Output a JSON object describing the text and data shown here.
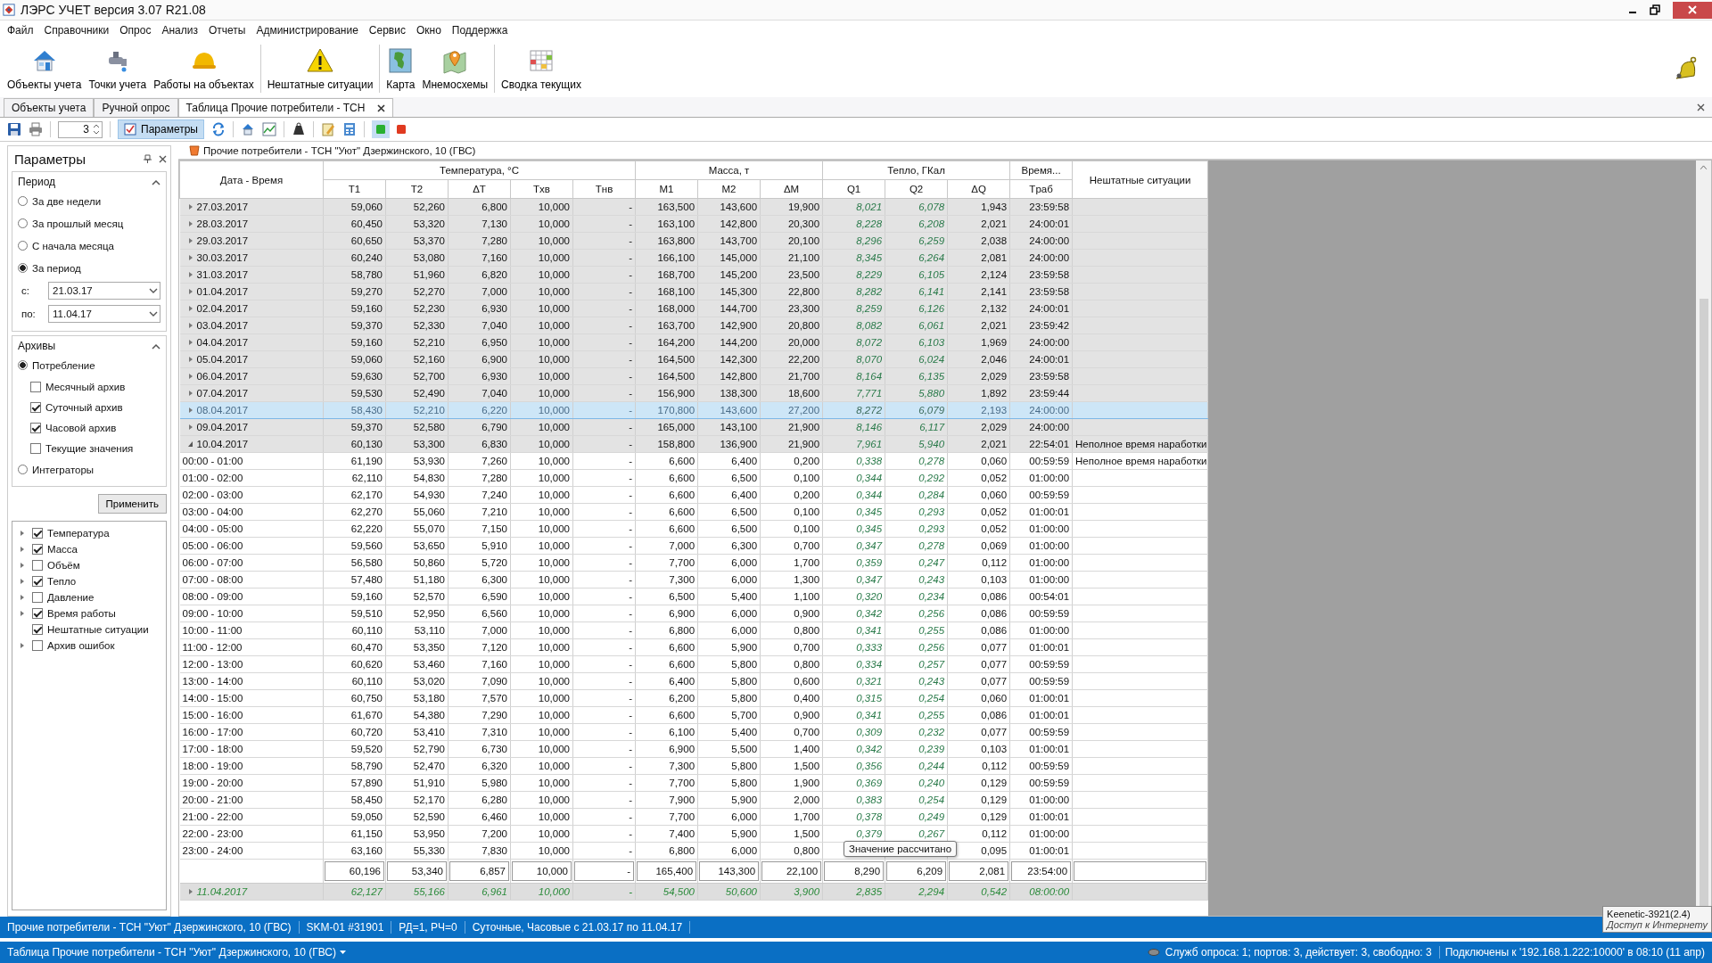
{
  "window": {
    "title": "ЛЭРС УЧЕТ версия 3.07 R21.08"
  },
  "menu": [
    "Файл",
    "Справочники",
    "Опрос",
    "Анализ",
    "Отчеты",
    "Администрирование",
    "Сервис",
    "Окно",
    "Поддержка"
  ],
  "toolbar": [
    {
      "label": "Объекты учета"
    },
    {
      "label": "Точки учета"
    },
    {
      "label": "Работы на объектах"
    },
    {
      "label": "Нештатные ситуации"
    },
    {
      "label": "Карта"
    },
    {
      "label": "Мнемосхемы"
    },
    {
      "label": "Сводка текущих"
    }
  ],
  "doc_tabs": [
    {
      "label": "Объекты учета",
      "selected": false
    },
    {
      "label": "Ручной опрос",
      "selected": false
    },
    {
      "label": "Таблица Прочие потребители - ТСН",
      "selected": true
    }
  ],
  "subtoolbar": {
    "counter": "3",
    "params_button": {
      "label": "Параметры",
      "selected": true
    }
  },
  "params_panel": {
    "title": "Параметры",
    "period": {
      "title": "Период",
      "options": [
        {
          "label": "За две недели",
          "selected": false
        },
        {
          "label": "За прошлый месяц",
          "selected": false
        },
        {
          "label": "С начала месяца",
          "selected": false
        },
        {
          "label": "За период",
          "selected": true
        }
      ],
      "from_label": "с:",
      "from": "21.03.17",
      "to_label": "по:",
      "to": "11.04.17"
    },
    "archives": {
      "title": "Архивы",
      "options": [
        {
          "label": "Потребление",
          "selected": true,
          "children": [
            {
              "label": "Месячный архив",
              "checked": false
            },
            {
              "label": "Суточный архив",
              "checked": true
            },
            {
              "label": "Часовой архив",
              "checked": true
            },
            {
              "label": "Текущие значения",
              "checked": false
            }
          ]
        },
        {
          "label": "Интеграторы",
          "selected": false
        }
      ]
    },
    "apply": "Применить",
    "tree": [
      {
        "label": "Температура",
        "checked": true,
        "has_children": true
      },
      {
        "label": "Масса",
        "checked": true,
        "has_children": true
      },
      {
        "label": "Объём",
        "checked": false,
        "has_children": true
      },
      {
        "label": "Тепло",
        "checked": true,
        "has_children": true
      },
      {
        "label": "Давление",
        "checked": false,
        "has_children": true
      },
      {
        "label": "Время работы",
        "checked": true,
        "has_children": true
      },
      {
        "label": "Нештатные ситуации",
        "checked": true,
        "has_children": false
      },
      {
        "label": "Архив ошибок",
        "checked": false,
        "has_children": true
      }
    ]
  },
  "data_title": "Прочие потребители - ТСН \"Уют\"  Дзержинского, 10 (ГВС)",
  "table": {
    "date_header": "Дата - Время",
    "events_header": "Нештатные ситуации",
    "groups": [
      {
        "label": "Температура, °C",
        "columns": [
          "T1",
          "T2",
          "ΔT",
          "Tхв",
          "Tнв"
        ]
      },
      {
        "label": "Масса, т",
        "columns": [
          "M1",
          "M2",
          "ΔM"
        ]
      },
      {
        "label": "Тепло, ГКал",
        "columns": [
          "Q1",
          "Q2",
          "ΔQ"
        ]
      },
      {
        "label": "Время...",
        "columns": [
          "Tраб"
        ]
      }
    ],
    "rows": [
      {
        "kind": "day",
        "expanded": false,
        "selected": false,
        "date": "27.03.2017",
        "cells": [
          "59,060",
          "52,260",
          "6,800",
          "10,000",
          "-",
          "163,500",
          "143,600",
          "19,900",
          "8,021",
          "6,078",
          "1,943",
          "23:59:58"
        ]
      },
      {
        "kind": "day",
        "expanded": false,
        "selected": false,
        "date": "28.03.2017",
        "cells": [
          "60,450",
          "53,320",
          "7,130",
          "10,000",
          "-",
          "163,100",
          "142,800",
          "20,300",
          "8,228",
          "6,208",
          "2,021",
          "24:00:01"
        ]
      },
      {
        "kind": "day",
        "expanded": false,
        "selected": false,
        "date": "29.03.2017",
        "cells": [
          "60,650",
          "53,370",
          "7,280",
          "10,000",
          "-",
          "163,800",
          "143,700",
          "20,100",
          "8,296",
          "6,259",
          "2,038",
          "24:00:00"
        ]
      },
      {
        "kind": "day",
        "expanded": false,
        "selected": false,
        "date": "30.03.2017",
        "cells": [
          "60,240",
          "53,080",
          "7,160",
          "10,000",
          "-",
          "166,100",
          "145,000",
          "21,100",
          "8,345",
          "6,264",
          "2,081",
          "24:00:00"
        ]
      },
      {
        "kind": "day",
        "expanded": false,
        "selected": false,
        "date": "31.03.2017",
        "cells": [
          "58,780",
          "51,960",
          "6,820",
          "10,000",
          "-",
          "168,700",
          "145,200",
          "23,500",
          "8,229",
          "6,105",
          "2,124",
          "23:59:58"
        ]
      },
      {
        "kind": "day",
        "expanded": false,
        "selected": false,
        "date": "01.04.2017",
        "cells": [
          "59,270",
          "52,270",
          "7,000",
          "10,000",
          "-",
          "168,100",
          "145,300",
          "22,800",
          "8,282",
          "6,141",
          "2,141",
          "23:59:58"
        ]
      },
      {
        "kind": "day",
        "expanded": false,
        "selected": false,
        "date": "02.04.2017",
        "cells": [
          "59,160",
          "52,230",
          "6,930",
          "10,000",
          "-",
          "168,000",
          "144,700",
          "23,300",
          "8,259",
          "6,126",
          "2,132",
          "24:00:01"
        ]
      },
      {
        "kind": "day",
        "expanded": false,
        "selected": false,
        "date": "03.04.2017",
        "cells": [
          "59,370",
          "52,330",
          "7,040",
          "10,000",
          "-",
          "163,700",
          "142,900",
          "20,800",
          "8,082",
          "6,061",
          "2,021",
          "23:59:42"
        ]
      },
      {
        "kind": "day",
        "expanded": false,
        "selected": false,
        "date": "04.04.2017",
        "cells": [
          "59,160",
          "52,210",
          "6,950",
          "10,000",
          "-",
          "164,200",
          "144,200",
          "20,000",
          "8,072",
          "6,103",
          "1,969",
          "24:00:00"
        ]
      },
      {
        "kind": "day",
        "expanded": false,
        "selected": false,
        "date": "05.04.2017",
        "cells": [
          "59,060",
          "52,160",
          "6,900",
          "10,000",
          "-",
          "164,500",
          "142,300",
          "22,200",
          "8,070",
          "6,024",
          "2,046",
          "24:00:01"
        ]
      },
      {
        "kind": "day",
        "expanded": false,
        "selected": false,
        "date": "06.04.2017",
        "cells": [
          "59,630",
          "52,700",
          "6,930",
          "10,000",
          "-",
          "164,500",
          "142,800",
          "21,700",
          "8,164",
          "6,135",
          "2,029",
          "23:59:58"
        ]
      },
      {
        "kind": "day",
        "expanded": false,
        "selected": false,
        "date": "07.04.2017",
        "cells": [
          "59,530",
          "52,490",
          "7,040",
          "10,000",
          "-",
          "156,900",
          "138,300",
          "18,600",
          "7,771",
          "5,880",
          "1,892",
          "23:59:44"
        ]
      },
      {
        "kind": "day",
        "expanded": false,
        "selected": true,
        "date": "08.04.2017",
        "cells": [
          "58,430",
          "52,210",
          "6,220",
          "10,000",
          "-",
          "170,800",
          "143,600",
          "27,200",
          "8,272",
          "6,079",
          "2,193",
          "24:00:00"
        ]
      },
      {
        "kind": "day",
        "expanded": false,
        "selected": false,
        "date": "09.04.2017",
        "cells": [
          "59,370",
          "52,580",
          "6,790",
          "10,000",
          "-",
          "165,000",
          "143,100",
          "21,900",
          "8,146",
          "6,117",
          "2,029",
          "24:00:00"
        ]
      },
      {
        "kind": "day",
        "expanded": true,
        "selected": false,
        "date": "10.04.2017",
        "cells": [
          "60,130",
          "53,300",
          "6,830",
          "10,000",
          "-",
          "158,800",
          "136,900",
          "21,900",
          "7,961",
          "5,940",
          "2,021",
          "22:54:01"
        ],
        "event": "Неполное время наработки"
      },
      {
        "kind": "hour",
        "date": "00:00 - 01:00",
        "cells": [
          "61,190",
          "53,930",
          "7,260",
          "10,000",
          "-",
          "6,600",
          "6,400",
          "0,200",
          "0,338",
          "0,278",
          "0,060",
          "00:59:59"
        ],
        "event": "Неполное время наработки"
      },
      {
        "kind": "hour",
        "date": "01:00 - 02:00",
        "cells": [
          "62,110",
          "54,830",
          "7,280",
          "10,000",
          "-",
          "6,600",
          "6,500",
          "0,100",
          "0,344",
          "0,292",
          "0,052",
          "01:00:00"
        ]
      },
      {
        "kind": "hour",
        "date": "02:00 - 03:00",
        "cells": [
          "62,170",
          "54,930",
          "7,240",
          "10,000",
          "-",
          "6,600",
          "6,400",
          "0,200",
          "0,344",
          "0,284",
          "0,060",
          "00:59:59"
        ]
      },
      {
        "kind": "hour",
        "date": "03:00 - 04:00",
        "cells": [
          "62,270",
          "55,060",
          "7,210",
          "10,000",
          "-",
          "6,600",
          "6,500",
          "0,100",
          "0,345",
          "0,293",
          "0,052",
          "01:00:01"
        ]
      },
      {
        "kind": "hour",
        "date": "04:00 - 05:00",
        "cells": [
          "62,220",
          "55,070",
          "7,150",
          "10,000",
          "-",
          "6,600",
          "6,500",
          "0,100",
          "0,345",
          "0,293",
          "0,052",
          "01:00:00"
        ]
      },
      {
        "kind": "hour",
        "date": "05:00 - 06:00",
        "cells": [
          "59,560",
          "53,650",
          "5,910",
          "10,000",
          "-",
          "7,000",
          "6,300",
          "0,700",
          "0,347",
          "0,278",
          "0,069",
          "01:00:00"
        ]
      },
      {
        "kind": "hour",
        "date": "06:00 - 07:00",
        "cells": [
          "56,580",
          "50,860",
          "5,720",
          "10,000",
          "-",
          "7,700",
          "6,000",
          "1,700",
          "0,359",
          "0,247",
          "0,112",
          "01:00:00"
        ]
      },
      {
        "kind": "hour",
        "date": "07:00 - 08:00",
        "cells": [
          "57,480",
          "51,180",
          "6,300",
          "10,000",
          "-",
          "7,300",
          "6,000",
          "1,300",
          "0,347",
          "0,243",
          "0,103",
          "01:00:00"
        ]
      },
      {
        "kind": "hour",
        "date": "08:00 - 09:00",
        "cells": [
          "59,160",
          "52,570",
          "6,590",
          "10,000",
          "-",
          "6,500",
          "5,400",
          "1,100",
          "0,320",
          "0,234",
          "0,086",
          "00:54:01"
        ]
      },
      {
        "kind": "hour",
        "date": "09:00 - 10:00",
        "cells": [
          "59,510",
          "52,950",
          "6,560",
          "10,000",
          "-",
          "6,900",
          "6,000",
          "0,900",
          "0,342",
          "0,256",
          "0,086",
          "00:59:59"
        ]
      },
      {
        "kind": "hour",
        "date": "10:00 - 11:00",
        "cells": [
          "60,110",
          "53,110",
          "7,000",
          "10,000",
          "-",
          "6,800",
          "6,000",
          "0,800",
          "0,341",
          "0,255",
          "0,086",
          "01:00:00"
        ]
      },
      {
        "kind": "hour",
        "date": "11:00 - 12:00",
        "cells": [
          "60,470",
          "53,350",
          "7,120",
          "10,000",
          "-",
          "6,600",
          "5,900",
          "0,700",
          "0,333",
          "0,256",
          "0,077",
          "01:00:01"
        ]
      },
      {
        "kind": "hour",
        "date": "12:00 - 13:00",
        "cells": [
          "60,620",
          "53,460",
          "7,160",
          "10,000",
          "-",
          "6,600",
          "5,800",
          "0,800",
          "0,334",
          "0,257",
          "0,077",
          "00:59:59"
        ]
      },
      {
        "kind": "hour",
        "date": "13:00 - 14:00",
        "cells": [
          "60,110",
          "53,020",
          "7,090",
          "10,000",
          "-",
          "6,400",
          "5,800",
          "0,600",
          "0,321",
          "0,243",
          "0,077",
          "00:59:59"
        ]
      },
      {
        "kind": "hour",
        "date": "14:00 - 15:00",
        "cells": [
          "60,750",
          "53,180",
          "7,570",
          "10,000",
          "-",
          "6,200",
          "5,800",
          "0,400",
          "0,315",
          "0,254",
          "0,060",
          "01:00:01"
        ]
      },
      {
        "kind": "hour",
        "date": "15:00 - 16:00",
        "cells": [
          "61,670",
          "54,380",
          "7,290",
          "10,000",
          "-",
          "6,600",
          "5,700",
          "0,900",
          "0,341",
          "0,255",
          "0,086",
          "01:00:01"
        ]
      },
      {
        "kind": "hour",
        "date": "16:00 - 17:00",
        "cells": [
          "60,720",
          "53,410",
          "7,310",
          "10,000",
          "-",
          "6,100",
          "5,400",
          "0,700",
          "0,309",
          "0,232",
          "0,077",
          "00:59:59"
        ]
      },
      {
        "kind": "hour",
        "date": "17:00 - 18:00",
        "cells": [
          "59,520",
          "52,790",
          "6,730",
          "10,000",
          "-",
          "6,900",
          "5,500",
          "1,400",
          "0,342",
          "0,239",
          "0,103",
          "01:00:01"
        ]
      },
      {
        "kind": "hour",
        "date": "18:00 - 19:00",
        "cells": [
          "58,790",
          "52,470",
          "6,320",
          "10,000",
          "-",
          "7,300",
          "5,800",
          "1,500",
          "0,356",
          "0,244",
          "0,112",
          "00:59:59"
        ]
      },
      {
        "kind": "hour",
        "date": "19:00 - 20:00",
        "cells": [
          "57,890",
          "51,910",
          "5,980",
          "10,000",
          "-",
          "7,700",
          "5,800",
          "1,900",
          "0,369",
          "0,240",
          "0,129",
          "00:59:59"
        ]
      },
      {
        "kind": "hour",
        "date": "20:00 - 21:00",
        "cells": [
          "58,450",
          "52,170",
          "6,280",
          "10,000",
          "-",
          "7,900",
          "5,900",
          "2,000",
          "0,383",
          "0,254",
          "0,129",
          "01:00:00"
        ]
      },
      {
        "kind": "hour",
        "date": "21:00 - 22:00",
        "cells": [
          "59,050",
          "52,590",
          "6,460",
          "10,000",
          "-",
          "7,700",
          "6,000",
          "1,700",
          "0,378",
          "0,249",
          "0,129",
          "01:00:01"
        ]
      },
      {
        "kind": "hour",
        "date": "22:00 - 23:00",
        "cells": [
          "61,150",
          "53,950",
          "7,200",
          "10,000",
          "-",
          "7,400",
          "5,900",
          "1,500",
          "0,379",
          "0,267",
          "0,112",
          "01:00:00"
        ]
      },
      {
        "kind": "hour",
        "date": "23:00 - 24:00",
        "cells": [
          "63,160",
          "55,330",
          "7,830",
          "10,000",
          "-",
          "6,800",
          "6,000",
          "0,800",
          null,
          null,
          "0,095",
          "01:00:01"
        ]
      }
    ],
    "totals": [
      "60,196",
      "53,340",
      "6,857",
      "10,000",
      "-",
      "165,400",
      "143,300",
      "22,100",
      "8,290",
      "6,209",
      "2,081",
      "23:54:00"
    ],
    "tail_row": {
      "expanded": false,
      "date": "11.04.2017",
      "cells": [
        "62,127",
        "55,166",
        "6,961",
        "10,000",
        "-",
        "54,500",
        "50,600",
        "3,900",
        "2,835",
        "2,294",
        "0,542",
        "08:00:00"
      ]
    },
    "tooltip": "Значение рассчитано"
  },
  "status_bar": [
    "Прочие потребители - ТСН \"Уют\"  Дзержинского, 10 (ГВС)",
    "SKM-01 #31901",
    "РД=1, РЧ=0",
    "Суточные, Часовые с 21.03.17 по 11.04.17"
  ],
  "bottom_bar": {
    "view": "Таблица Прочие потребители - ТСН \"Уют\"  Дзержинского, 10 (ГВС)",
    "services": "Служб опроса: 1; портов: 3, действует: 3, свободно: 3",
    "connection": "Подключены к '192.168.1.222:10000' в 08:10 (11 апр)"
  },
  "notification": {
    "title": "Keenetic-3921(2.4)",
    "text": "Доступ к Интернету"
  }
}
